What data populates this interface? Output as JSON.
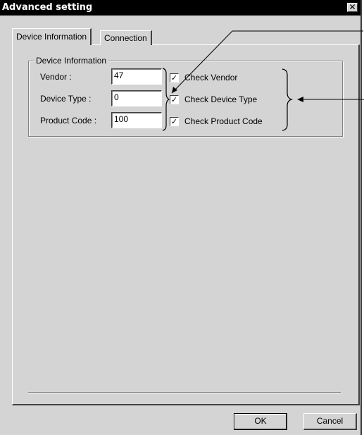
{
  "window": {
    "title": "Advanced setting"
  },
  "tabs": [
    {
      "label": "Device Information",
      "active": true
    },
    {
      "label": "Connection",
      "active": false
    }
  ],
  "group": {
    "title": "Device Information",
    "rows": [
      {
        "label": "Vendor :",
        "value": "47",
        "check_label": "Check Vendor",
        "checked": true
      },
      {
        "label": "Device Type :",
        "value": "0",
        "check_label": "Check Device Type",
        "checked": true
      },
      {
        "label": "Product Code :",
        "value": "100",
        "check_label": "Check Product Code",
        "checked": true
      }
    ]
  },
  "buttons": {
    "ok": "OK",
    "cancel": "Cancel"
  },
  "icons": {
    "close": "close-icon",
    "check": "checkmark-icon"
  }
}
